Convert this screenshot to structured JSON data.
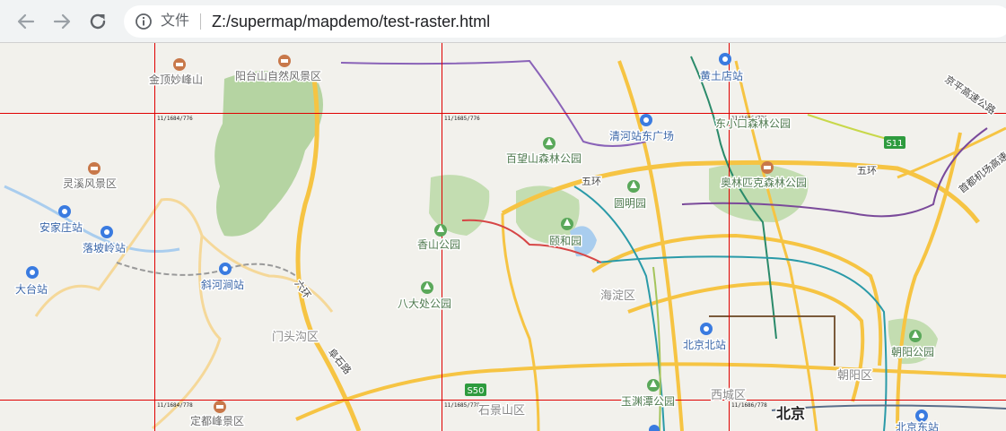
{
  "browser": {
    "back_icon": "arrow-left-icon",
    "forward_icon": "arrow-right-icon",
    "reload_icon": "reload-icon",
    "info_icon": "info-icon",
    "security_label": "文件",
    "url": "Z:/supermap/mapdemo/test-raster.html"
  },
  "map": {
    "tile_labels": [
      "11/1684/776",
      "11/1685/776",
      "11/1686/776",
      "11/1684/778",
      "11/1685/778",
      "11/1686/778"
    ],
    "poi": {
      "jinding": "金顶妙峰山",
      "yangtai": "阳台山自然风景区",
      "lingxi": "灵溪风景区",
      "dingdu": "定都峰景区"
    },
    "stations": {
      "huangtudian": "黄土店站",
      "qinghe": "清河站东广场",
      "anjiazhuang": "安家庄站",
      "luopoling": "落坡岭站",
      "datai": "大台站",
      "xiehedian": "斜河涧站",
      "beijingbei": "北京北站",
      "beijingdong": "北京东站"
    },
    "parks": {
      "dongxiaokou": "东小口森林公园",
      "baiwangshan": "百望山森林公园",
      "yuanmingyuan": "圆明园",
      "aolinpike": "奥林匹克森林公园",
      "xiangshan": "香山公园",
      "yiheyuan": "颐和园",
      "badachu": "八大处公园",
      "chaoyang": "朝阳公园",
      "yuyuantan": "玉渊潭公园"
    },
    "districts": {
      "haidian": "海淀区",
      "mentougou": "门头沟区",
      "chaoyang": "朝阳区",
      "xicheng": "西城区",
      "shijingshan": "石景山区"
    },
    "city": "北京",
    "roads": {
      "ring5_a": "五环",
      "ring5_b": "五环",
      "liuhuan": "六环",
      "fushi": "阜石路",
      "jingping": "京平高速公路",
      "airport": "首都机场高速"
    },
    "shields": {
      "s11": "S11",
      "s50": "S50"
    }
  }
}
